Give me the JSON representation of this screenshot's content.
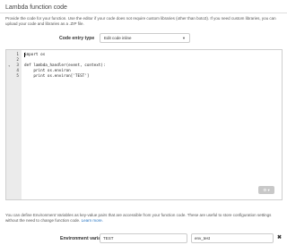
{
  "section": {
    "title": "Lambda function code",
    "description": "Provide the code for your function. Use the editor if your code does not require custom libraries (other than boto3). If you need custom libraries, you can upload your code and libraries as a .ZIP file."
  },
  "code_entry": {
    "label": "Code entry type",
    "selected": "Edit code inline"
  },
  "editor": {
    "lines": [
      {
        "num": "1",
        "text": "import os"
      },
      {
        "num": "2",
        "text": ""
      },
      {
        "num": "3",
        "text": "def lambda_handler(event, context):"
      },
      {
        "num": "4",
        "text": "    print os.environ"
      },
      {
        "num": "5",
        "text": "    print os.environ['TEST']"
      }
    ],
    "fold_marker": "▾"
  },
  "env": {
    "description": "You can define Environment Variables as key-value pairs that are accessible from your function code. These are useful to store configuration settings without the need to change function code.",
    "learn_more": "Learn more.",
    "label": "Environment variables",
    "key": "TEST",
    "value": "env_test",
    "remove_symbol": "✖"
  },
  "icons": {
    "settings": "gear-icon",
    "dropdown": "chevron-down-icon",
    "remove": "close-icon"
  }
}
